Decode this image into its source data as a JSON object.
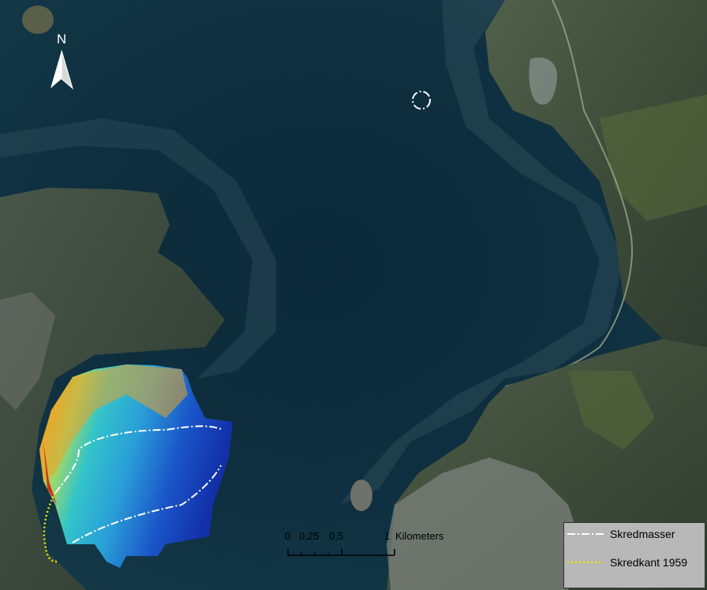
{
  "map": {
    "north_arrow": {
      "label": "N"
    },
    "scale_bar": {
      "ticks": [
        "0",
        "0,25",
        "0,5",
        "1"
      ],
      "unit": "Kilometers"
    },
    "legend": {
      "items": [
        {
          "label": "Skredmasser",
          "symbol": "dash-dot-line",
          "color": "#ffffff"
        },
        {
          "label": "Skredkant 1959",
          "symbol": "dotted-line",
          "color": "#f2e600"
        }
      ]
    },
    "colors": {
      "water": "#0f2b38",
      "land": "#3a4a3c",
      "legend_bg": "#b8b8b8"
    }
  }
}
